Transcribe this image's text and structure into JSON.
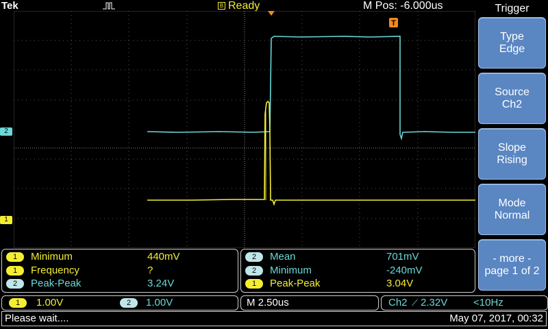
{
  "header": {
    "brand": "Tek",
    "acquisition_state": "Ready",
    "status_icon": "status-square-icon",
    "horizontal_position": "M Pos: -6.000us"
  },
  "channels": {
    "ch1": {
      "label": "1",
      "color": "#f4ee33"
    },
    "ch2": {
      "label": "2",
      "color": "#6ad8d8"
    }
  },
  "side_menu": {
    "title": "Trigger",
    "buttons": [
      {
        "line1": "Type",
        "line2": "Edge"
      },
      {
        "line1": "Source",
        "line2": "Ch2"
      },
      {
        "line1": "Slope",
        "line2": "Rising"
      },
      {
        "line1": "Mode",
        "line2": "Normal"
      },
      {
        "line1": "- more -",
        "line2": "page 1 of 2"
      }
    ]
  },
  "measurements_left": [
    {
      "channel": "1",
      "name": "Minimum",
      "value": "440mV"
    },
    {
      "channel": "1",
      "name": "Frequency",
      "value": "?"
    },
    {
      "channel": "2",
      "name": "Peak-Peak",
      "value": "3.24V"
    }
  ],
  "measurements_right": [
    {
      "channel": "2",
      "name": "Mean",
      "value": "701mV"
    },
    {
      "channel": "2",
      "name": "Minimum",
      "value": "-240mV"
    },
    {
      "channel": "1",
      "name": "Peak-Peak",
      "value": "3.04V"
    }
  ],
  "scale": {
    "ch1_badge": "1",
    "ch1_scale": "1.00V",
    "ch2_badge": "2",
    "ch2_scale": "1.00V",
    "timebase": "M 2.50us",
    "trigger_source": "Ch2",
    "trigger_slope_symbol": "⟋",
    "trigger_level": "2.32V",
    "trigger_frequency": "<10Hz"
  },
  "status_bar": {
    "message": "Please wait....",
    "datetime": "May 07, 2017, 00:32"
  }
}
